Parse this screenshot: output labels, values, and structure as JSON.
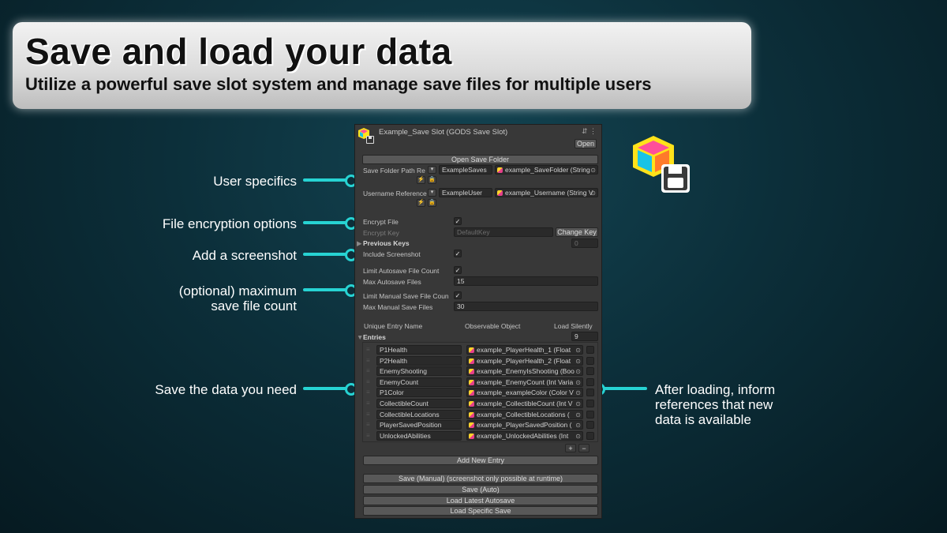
{
  "banner": {
    "title": "Save and load your data",
    "subtitle": "Utilize a powerful save slot system and manage save files for multiple users"
  },
  "callouts": {
    "user_specifics": "User specifics",
    "file_encryption": "File encryption options",
    "add_screenshot": "Add a screenshot",
    "max_count_line1": "(optional) maximum",
    "max_count_line2": "save file count",
    "save_data": "Save the data you need",
    "after_loading_line1": "After loading, inform",
    "after_loading_line2": "references that new",
    "after_loading_line3": "data is available"
  },
  "inspector": {
    "title": "Example_Save Slot (GODS Save Slot)",
    "header_icons": "⇵ ⋮",
    "open_button": "Open",
    "open_save_folder_button": "Open Save Folder",
    "save_folder_path_label": "Save Folder Path Re",
    "save_folder_value": "ExampleSaves",
    "save_folder_ref": "example_SaveFolder (String",
    "username_label": "Username Reference",
    "username_value": "ExampleUser",
    "username_ref": "example_Username (String V",
    "encrypt_file_label": "Encrypt File",
    "encrypt_key_label": "Encrypt Key",
    "encrypt_key_placeholder": "DefaultKey",
    "change_key_button": "Change Key",
    "previous_keys_label": "Previous Keys",
    "previous_keys_count": "0",
    "include_screenshot_label": "Include Screenshot",
    "limit_autosave_label": "Limit Autosave File Count",
    "max_autosave_label": "Max Autosave Files",
    "max_autosave_value": "15",
    "limit_manual_label": "Limit Manual Save File Coun",
    "max_manual_label": "Max Manual Save Files",
    "max_manual_value": "30",
    "col_unique_entry": "Unique Entry Name",
    "col_observable": "Observable Object",
    "col_load_silently": "Load Silently",
    "entries_label": "Entries",
    "entries_count": "9",
    "entries": [
      {
        "name": "P1Health",
        "ref": "example_PlayerHealth_1 (Float"
      },
      {
        "name": "P2Health",
        "ref": "example_PlayerHealth_2 (Float"
      },
      {
        "name": "EnemyShooting",
        "ref": "example_EnemyIsShooting (Boo"
      },
      {
        "name": "EnemyCount",
        "ref": "example_EnemyCount (Int Varia"
      },
      {
        "name": "P1Color",
        "ref": "example_exampleColor (Color V"
      },
      {
        "name": "CollectibleCount",
        "ref": "example_CollectibleCount (Int V"
      },
      {
        "name": "CollectibleLocations",
        "ref": "example_CollectibleLocations ("
      },
      {
        "name": "PlayerSavedPosition",
        "ref": "example_PlayerSavedPosition ("
      },
      {
        "name": "UnlockedAbilities",
        "ref": "example_UnlockedAbilities (Int"
      }
    ],
    "plus_label": "+",
    "minus_label": "−",
    "add_new_entry_button": "Add New Entry",
    "save_manual_button": "Save (Manual) (screenshot only possible at runtime)",
    "save_auto_button": "Save (Auto)",
    "load_latest_button": "Load Latest Autosave",
    "load_specific_button": "Load Specific Save"
  },
  "colors": {
    "accent": "#27d3d3",
    "panel_bg": "#383838"
  }
}
